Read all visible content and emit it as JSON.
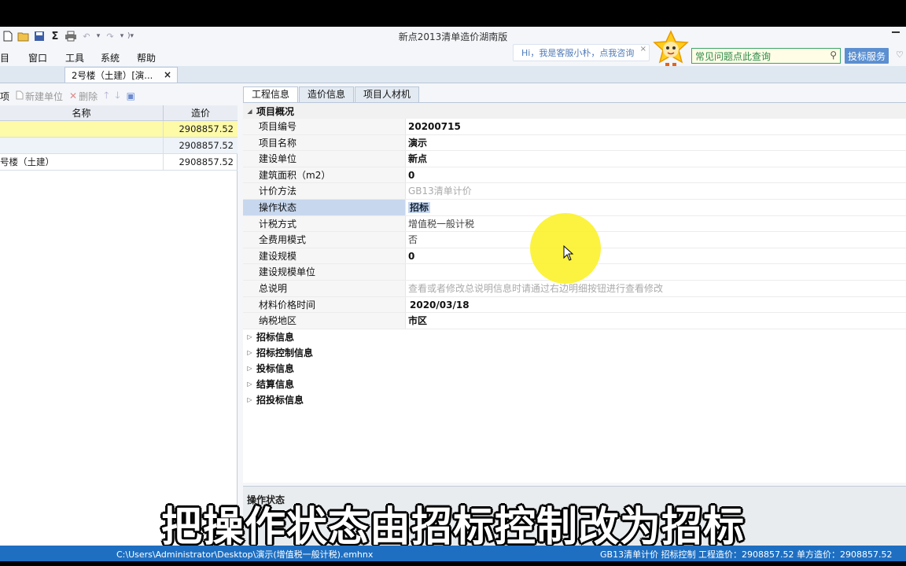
{
  "window": {
    "title": "新点2013清单造价湖南版"
  },
  "quick_access": [
    "new-icon",
    "open-icon",
    "save-icon",
    "sum-icon",
    "print-icon",
    "undo-icon",
    "redo-icon"
  ],
  "menu": [
    "目",
    "窗口",
    "工具",
    "系统",
    "帮助"
  ],
  "assistant": {
    "text": "Hi，我是客服小朴，点我咨询",
    "close": "×"
  },
  "help_search": {
    "placeholder": "常见问题点此查询"
  },
  "bid_service": "投标服务",
  "doc_tab": {
    "label": "2号楼（土建）[演...",
    "close": "×"
  },
  "left_toolbar": {
    "item0": "项",
    "new_unit": "新建单位",
    "delete": "删除"
  },
  "left_table": {
    "headers": [
      "名称",
      "造价"
    ],
    "rows": [
      {
        "name": "",
        "price": "2908857.52"
      },
      {
        "name": "",
        "price": "2908857.52"
      },
      {
        "name": "号楼（土建）",
        "price": "2908857.52"
      }
    ]
  },
  "right_tabs": [
    "工程信息",
    "造价信息",
    "项目人材机"
  ],
  "overview": {
    "group": "项目概况",
    "props": [
      {
        "k": "项目编号",
        "v": "20200715"
      },
      {
        "k": "项目名称",
        "v": "演示"
      },
      {
        "k": "建设单位",
        "v": "新点"
      },
      {
        "k": "建筑面积（m2）",
        "v": "0"
      },
      {
        "k": "计价方法",
        "v": "GB13清单计价"
      },
      {
        "k": "操作状态",
        "v": "招标"
      },
      {
        "k": "计税方式",
        "v": "增值税一般计税"
      },
      {
        "k": "全费用模式",
        "v": "否"
      },
      {
        "k": "建设规模",
        "v": "0"
      },
      {
        "k": "建设规模单位",
        "v": ""
      },
      {
        "k": "总说明",
        "v": "查看或者修改总说明信息时请通过右边明细按钮进行查看修改"
      },
      {
        "k": "材料价格时间",
        "v": "2020/03/18"
      },
      {
        "k": "纳税地区",
        "v": "市区"
      }
    ]
  },
  "groups": [
    "招标信息",
    "招标控制信息",
    "投标信息",
    "结算信息",
    "招投标信息"
  ],
  "desc_panel": {
    "title": "操作状态"
  },
  "subtitle": "把操作状态由招标控制改为招标",
  "status": {
    "path": "C:\\Users\\Administrator\\Desktop\\演示(增值税一般计税).emhnx",
    "info": "GB13清单计价  招标控制  工程造价：2908857.52  单方造价：2908857.52"
  },
  "colors": {
    "status_bar": "#1e6fc2",
    "selected_row": "#fdfaa8",
    "highlight": "#c7d7ee",
    "cursor_spot": "#fbf22a"
  }
}
